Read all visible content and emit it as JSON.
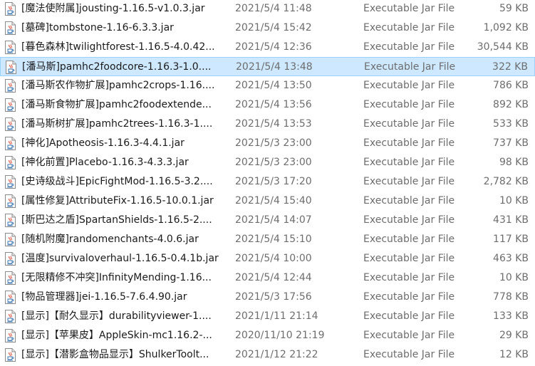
{
  "files": [
    {
      "name": "[魔法使附属]jousting-1.16.5-v1.0.3.jar",
      "date": "2021/5/4 11:48",
      "type": "Executable Jar File",
      "size": "59 KB",
      "icon": "java-jar-icon"
    },
    {
      "name": "[墓碑]tombstone-1.16-6.3.3.jar",
      "date": "2021/5/4 15:42",
      "type": "Executable Jar File",
      "size": "1,092 KB",
      "icon": "java-jar-icon"
    },
    {
      "name": "[暮色森林]twilightforest-1.16.5-4.0.42...",
      "date": "2021/5/4 12:36",
      "type": "Executable Jar File",
      "size": "30,544 KB",
      "icon": "java-jar-icon"
    },
    {
      "name": "[潘马斯]pamhc2foodcore-1.16.3-1.0....",
      "date": "2021/5/4 13:48",
      "type": "Executable Jar File",
      "size": "322 KB",
      "icon": "java-jar-icon",
      "selected": true
    },
    {
      "name": "[潘马斯农作物扩展]pamhc2crops-1.16....",
      "date": "2021/5/4 13:50",
      "type": "Executable Jar File",
      "size": "786 KB",
      "icon": "java-jar-icon"
    },
    {
      "name": "[潘马斯食物扩展]pamhc2foodextende...",
      "date": "2021/5/4 13:56",
      "type": "Executable Jar File",
      "size": "892 KB",
      "icon": "java-jar-icon"
    },
    {
      "name": "[潘马斯树扩展]pamhc2trees-1.16.3-1....",
      "date": "2021/5/4 13:53",
      "type": "Executable Jar File",
      "size": "533 KB",
      "icon": "java-jar-icon"
    },
    {
      "name": "[神化]Apotheosis-1.16.3-4.4.1.jar",
      "date": "2021/5/3 23:00",
      "type": "Executable Jar File",
      "size": "737 KB",
      "icon": "java-jar-icon"
    },
    {
      "name": "[神化前置]Placebo-1.16.3-4.3.3.jar",
      "date": "2021/5/3 23:00",
      "type": "Executable Jar File",
      "size": "98 KB",
      "icon": "java-jar-icon"
    },
    {
      "name": "[史诗级战斗]EpicFightMod-1.16.5-3.2....",
      "date": "2021/5/3 17:20",
      "type": "Executable Jar File",
      "size": "2,782 KB",
      "icon": "java-jar-icon"
    },
    {
      "name": "[属性修复]AttributeFix-1.16.5-10.0.1.jar",
      "date": "2021/5/4 15:40",
      "type": "Executable Jar File",
      "size": "10 KB",
      "icon": "java-jar-icon"
    },
    {
      "name": "[斯巴达之盾]SpartanShields-1.16.5-2....",
      "date": "2021/5/4 14:07",
      "type": "Executable Jar File",
      "size": "431 KB",
      "icon": "java-jar-icon"
    },
    {
      "name": "[随机附魔]randomenchants-4.0.6.jar",
      "date": "2021/5/4 15:10",
      "type": "Executable Jar File",
      "size": "117 KB",
      "icon": "java-jar-icon"
    },
    {
      "name": "[温度]survivaloverhaul-1.16.5-0.4.1b.jar",
      "date": "2021/5/4 10:00",
      "type": "Executable Jar File",
      "size": "463 KB",
      "icon": "java-jar-icon"
    },
    {
      "name": "[无限精修不冲突]InfinityMending-1.16...",
      "date": "2021/5/4 12:44",
      "type": "Executable Jar File",
      "size": "10 KB",
      "icon": "java-jar-icon"
    },
    {
      "name": "[物品管理器]jei-1.16.5-7.6.4.90.jar",
      "date": "2021/5/3 17:56",
      "type": "Executable Jar File",
      "size": "778 KB",
      "icon": "java-jar-icon"
    },
    {
      "name": "[显示]【耐久显示】durabilityviewer-1....",
      "date": "2021/1/11 21:14",
      "type": "Executable Jar File",
      "size": "133 KB",
      "icon": "java-jar-icon"
    },
    {
      "name": "[显示]【苹果皮】AppleSkin-mc1.16.2-...",
      "date": "2020/11/10 21:19",
      "type": "Executable Jar File",
      "size": "29 KB",
      "icon": "java-jar-icon"
    },
    {
      "name": "[显示]【潜影盒物品显示】ShulkerToolt...",
      "date": "2021/1/12 21:22",
      "type": "Executable Jar File",
      "size": "12 KB",
      "icon": "java-jar-icon"
    }
  ],
  "colors": {
    "selection_bg": "#cde8ff",
    "selection_border": "#99d1ff",
    "secondary_text": "#6d6d6d",
    "primary_text": "#1a1a1a"
  }
}
